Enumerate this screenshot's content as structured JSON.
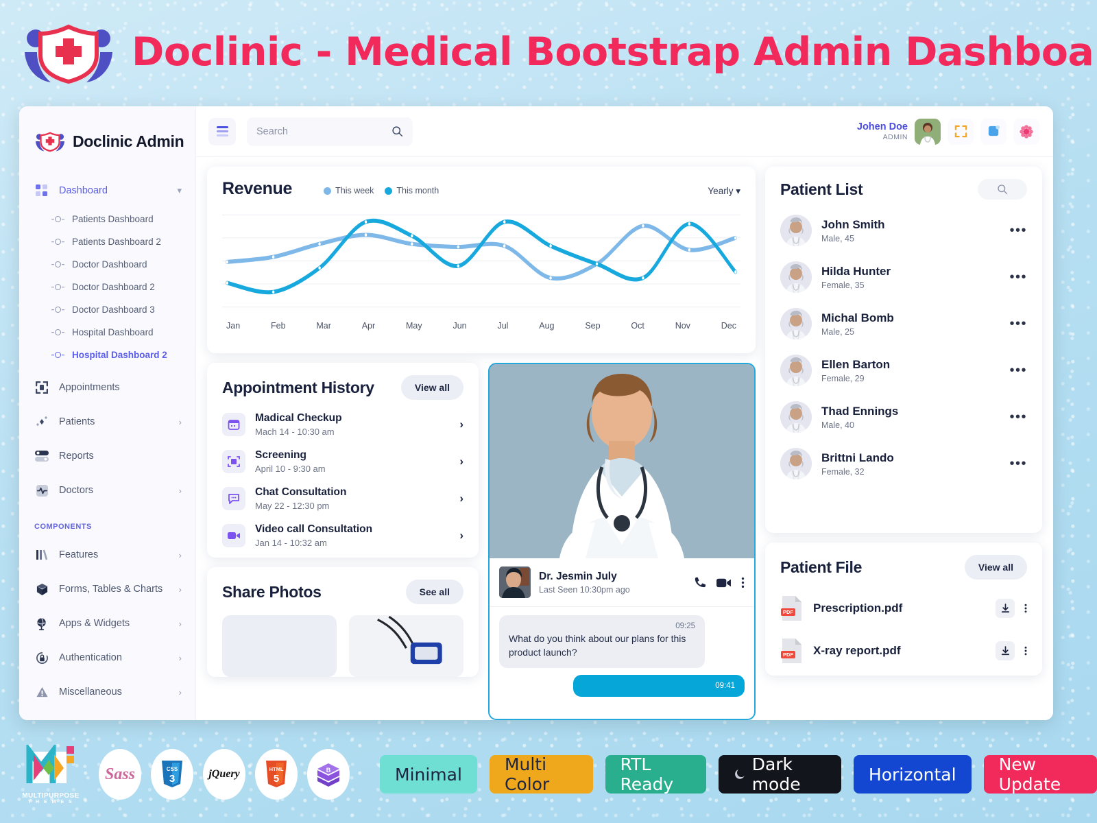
{
  "banner": {
    "title": "Doclinic - Medical Bootstrap Admin Dashboard",
    "logo_icon": "doclinic-shield-logo"
  },
  "sidebar": {
    "brand": "Doclinic Admin",
    "dashboard": {
      "label": "Dashboard",
      "icon": "grid-icon",
      "chevron": "chevron-down-icon"
    },
    "sub_items": [
      {
        "label": "Patients Dashboard",
        "active": false
      },
      {
        "label": "Patients Dashboard 2",
        "active": false
      },
      {
        "label": "Doctor Dashboard",
        "active": false
      },
      {
        "label": "Doctor Dashboard 2",
        "active": false
      },
      {
        "label": "Doctor Dashboard 3",
        "active": false
      },
      {
        "label": "Hospital Dashboard",
        "active": false
      },
      {
        "label": "Hospital Dashboard 2",
        "active": true
      }
    ],
    "items": [
      {
        "label": "Appointments",
        "icon": "appointments-icon",
        "chevron": ""
      },
      {
        "label": "Patients",
        "icon": "patients-icon",
        "chevron": "›"
      },
      {
        "label": "Reports",
        "icon": "reports-icon",
        "chevron": ""
      },
      {
        "label": "Doctors",
        "icon": "doctors-pulse-icon",
        "chevron": "›"
      }
    ],
    "section_title": "COMPONENTS",
    "component_items": [
      {
        "label": "Features",
        "icon": "features-icon",
        "chevron": "›"
      },
      {
        "label": "Forms, Tables & Charts",
        "icon": "cube-icon",
        "chevron": "›"
      },
      {
        "label": "Apps & Widgets",
        "icon": "globe-icon",
        "chevron": "›"
      },
      {
        "label": "Authentication",
        "icon": "lock-icon",
        "chevron": "›"
      },
      {
        "label": "Miscellaneous",
        "icon": "warning-icon",
        "chevron": "›"
      }
    ]
  },
  "topbar": {
    "menu_icon": "hamburger-icon",
    "search_placeholder": "Search",
    "search_value": "",
    "search_icon": "search-icon",
    "user_name": "Johen Doe",
    "user_role": "ADMIN",
    "avatar": "user-avatar",
    "fullscreen_icon": "fullscreen-icon",
    "messages_icon": "messages-icon",
    "notifications_icon": "notifications-icon"
  },
  "revenue": {
    "title": "Revenue",
    "dropdown": "Yearly",
    "dropdown_caret": "▾",
    "legend": [
      {
        "label": "This week",
        "color": "#7db8e8"
      },
      {
        "label": "This month",
        "color": "#17a8dd"
      }
    ]
  },
  "chart_data": {
    "type": "line",
    "title": "Revenue",
    "xlabel": "",
    "ylabel": "",
    "grid": true,
    "legend_position": "top-center",
    "categories": [
      "Jan",
      "Feb",
      "Mar",
      "Apr",
      "May",
      "Jun",
      "Jul",
      "Aug",
      "Sep",
      "Oct",
      "Nov",
      "Dec"
    ],
    "ylim": [
      0,
      100
    ],
    "series": [
      {
        "name": "This week",
        "color": "#7db8e8",
        "values": [
          48,
          53,
          66,
          75,
          66,
          63,
          64,
          32,
          46,
          84,
          60,
          72
        ]
      },
      {
        "name": "This month",
        "color": "#17a8dd",
        "values": [
          27,
          18,
          42,
          88,
          74,
          44,
          88,
          64,
          46,
          32,
          86,
          38
        ]
      }
    ]
  },
  "appointments": {
    "title": "Appointment History",
    "view_all": "View all",
    "rows": [
      {
        "name": "Madical Checkup",
        "date": "Mach 14 - 10:30 am",
        "icon": "calendar-icon"
      },
      {
        "name": "Screening",
        "date": "April 10 - 9:30 am",
        "icon": "scan-icon"
      },
      {
        "name": "Chat Consultation",
        "date": "May 22 - 12:30 pm",
        "icon": "chat-icon"
      },
      {
        "name": "Video call Consultation",
        "date": "Jan 14 - 10:32 am",
        "icon": "video-icon"
      }
    ],
    "chevron": "›"
  },
  "share_photos": {
    "title": "Share Photos",
    "see_all": "See all"
  },
  "chat": {
    "doctor_name": "Dr. Jesmin July",
    "last_seen": "Last Seen 10:30pm ago",
    "call_icon": "phone-icon",
    "video_icon": "video-camera-icon",
    "more_icon": "kebab-menu-icon",
    "messages": [
      {
        "time": "09:25",
        "text": "What do you think about our plans for this product launch?",
        "from": "them"
      },
      {
        "time": "09:41",
        "text": "",
        "from": "me"
      }
    ]
  },
  "patient_list": {
    "title": "Patient List",
    "search_icon": "search-icon",
    "patients": [
      {
        "name": "John Smith",
        "sub": "Male, 45"
      },
      {
        "name": "Hilda Hunter",
        "sub": "Female, 35"
      },
      {
        "name": "Michal Bomb",
        "sub": "Male, 25"
      },
      {
        "name": "Ellen Barton",
        "sub": "Female, 29"
      },
      {
        "name": "Thad Ennings",
        "sub": "Male, 40"
      },
      {
        "name": "Brittni Lando",
        "sub": "Female, 32"
      }
    ],
    "row_menu": "•••"
  },
  "patient_file": {
    "title": "Patient File",
    "view_all": "View all",
    "files": [
      {
        "name": "Prescription.pdf",
        "type": "PDF"
      },
      {
        "name": "X-ray report.pdf",
        "type": "PDF"
      }
    ],
    "download_icon": "download-icon",
    "more_icon": "kebab-menu-icon"
  },
  "footer": {
    "brand_caption": "MULTIPURPOSE",
    "brand_sub": "T H E M E S",
    "tech_icons": [
      "sass-icon",
      "css3-icon",
      "jquery-icon",
      "html5-icon",
      "bootstrap-icon"
    ],
    "badges": [
      {
        "label": "Minimal",
        "bg": "#6fdfd3",
        "fg": "#1d2540"
      },
      {
        "label": "Multi Color",
        "bg": "#efa81c",
        "fg": "#1d2540"
      },
      {
        "label": "RTL Ready",
        "bg": "#2aaf8e",
        "fg": "#ffffff"
      },
      {
        "label": "Dark mode",
        "bg": "#13151c",
        "fg": "#ffffff",
        "icon": "moon-icon"
      },
      {
        "label": "Horizontal",
        "bg": "#1347d2",
        "fg": "#ffffff"
      },
      {
        "label": "New Update",
        "bg": "#f2295b",
        "fg": "#ffffff"
      }
    ]
  }
}
